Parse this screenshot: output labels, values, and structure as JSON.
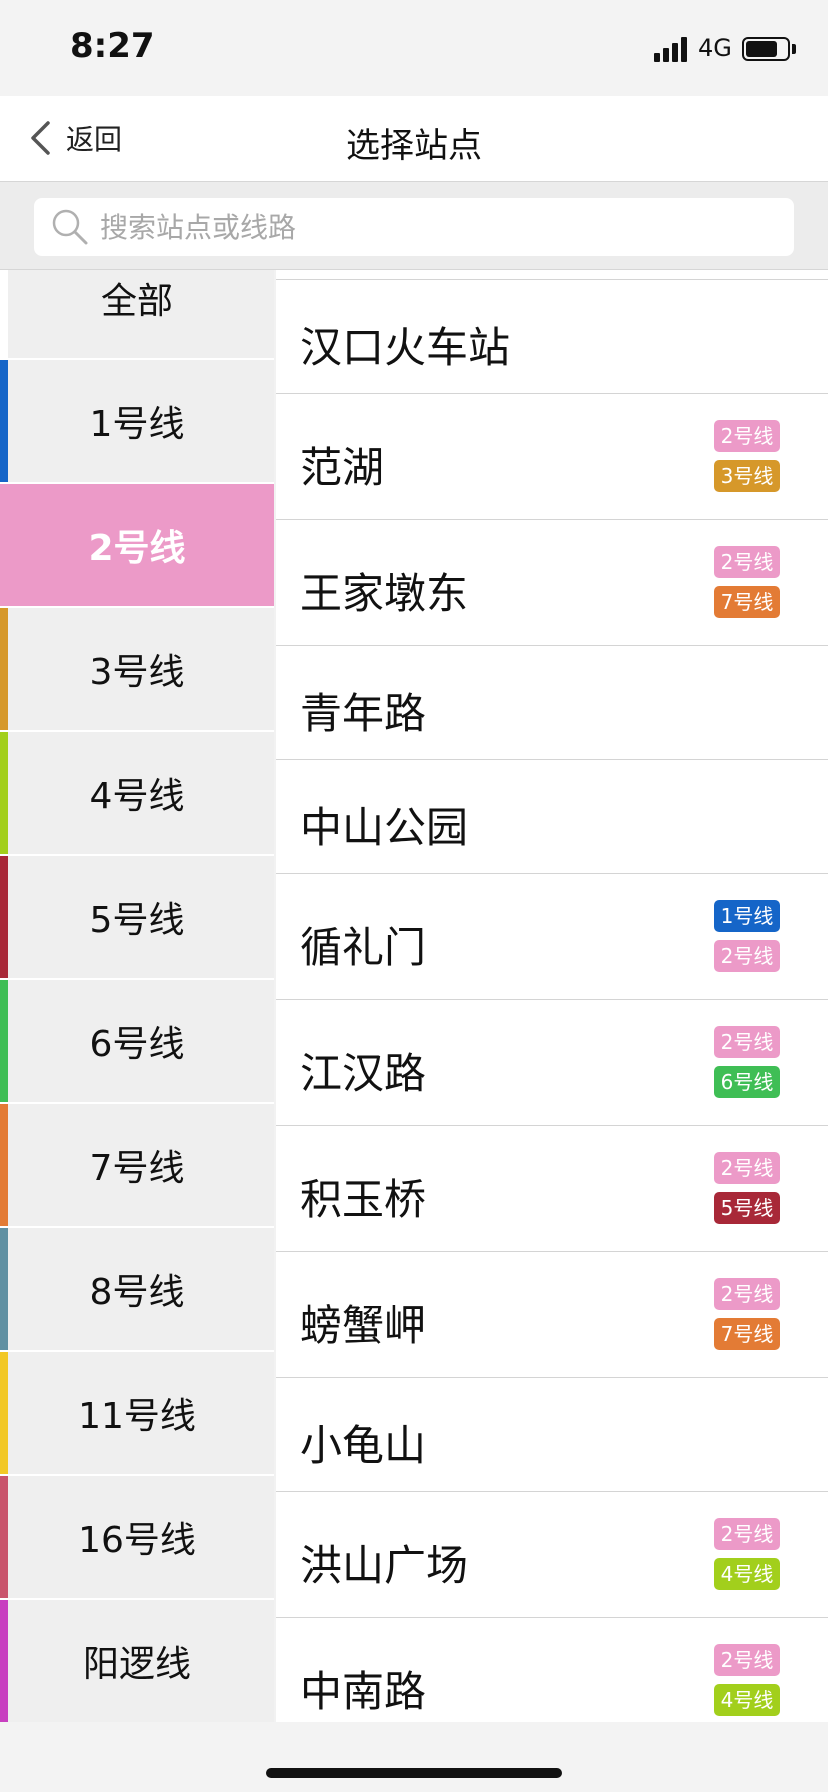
{
  "status": {
    "time": "8:27",
    "network": "4G",
    "battery_level": 0.78
  },
  "nav": {
    "back_label": "返回",
    "title": "选择站点"
  },
  "search": {
    "placeholder": "搜索站点或线路",
    "value": ""
  },
  "lines": [
    {
      "label": "全部",
      "color": "#ffffff",
      "selected": false
    },
    {
      "label": "1号线",
      "color": "#1565c8",
      "selected": false
    },
    {
      "label": "2号线",
      "color": "#ec9ac8",
      "selected": true
    },
    {
      "label": "3号线",
      "color": "#d6982a",
      "selected": false
    },
    {
      "label": "4号线",
      "color": "#a2cf1c",
      "selected": false
    },
    {
      "label": "5号线",
      "color": "#a82838",
      "selected": false
    },
    {
      "label": "6号线",
      "color": "#3fbe55",
      "selected": false
    },
    {
      "label": "7号线",
      "color": "#e37b35",
      "selected": false
    },
    {
      "label": "8号线",
      "color": "#6090a2",
      "selected": false
    },
    {
      "label": "11号线",
      "color": "#f2c826",
      "selected": false
    },
    {
      "label": "16号线",
      "color": "#c9546c",
      "selected": false
    },
    {
      "label": "阳逻线",
      "color": "#c83fc0",
      "selected": false
    }
  ],
  "stations": [
    {
      "name": "汉口火车站",
      "badges": []
    },
    {
      "name": "范湖",
      "badges": [
        {
          "label": "2号线",
          "color": "#ec9ac8"
        },
        {
          "label": "3号线",
          "color": "#d6982a"
        }
      ]
    },
    {
      "name": "王家墩东",
      "badges": [
        {
          "label": "2号线",
          "color": "#ec9ac8"
        },
        {
          "label": "7号线",
          "color": "#e37b35"
        }
      ]
    },
    {
      "name": "青年路",
      "badges": []
    },
    {
      "name": "中山公园",
      "badges": []
    },
    {
      "name": "循礼门",
      "badges": [
        {
          "label": "1号线",
          "color": "#1565c8"
        },
        {
          "label": "2号线",
          "color": "#ec9ac8"
        }
      ]
    },
    {
      "name": "江汉路",
      "badges": [
        {
          "label": "2号线",
          "color": "#ec9ac8"
        },
        {
          "label": "6号线",
          "color": "#3fbe55"
        }
      ]
    },
    {
      "name": "积玉桥",
      "badges": [
        {
          "label": "2号线",
          "color": "#ec9ac8"
        },
        {
          "label": "5号线",
          "color": "#a82838"
        }
      ]
    },
    {
      "name": "螃蟹岬",
      "badges": [
        {
          "label": "2号线",
          "color": "#ec9ac8"
        },
        {
          "label": "7号线",
          "color": "#e37b35"
        }
      ]
    },
    {
      "name": "小龟山",
      "badges": []
    },
    {
      "name": "洪山广场",
      "badges": [
        {
          "label": "2号线",
          "color": "#ec9ac8"
        },
        {
          "label": "4号线",
          "color": "#a2cf1c"
        }
      ]
    },
    {
      "name": "中南路",
      "badges": [
        {
          "label": "2号线",
          "color": "#ec9ac8"
        },
        {
          "label": "4号线",
          "color": "#a2cf1c"
        }
      ]
    }
  ]
}
